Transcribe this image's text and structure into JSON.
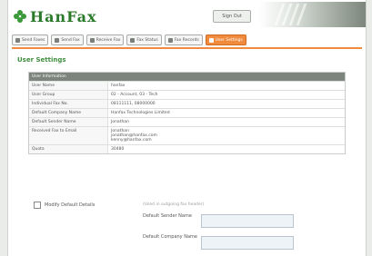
{
  "header": {
    "logo_text": "HanFax",
    "signout_label": "Sign Out"
  },
  "nav": {
    "items": [
      {
        "label": "Send Faxes",
        "icon": "send-icon"
      },
      {
        "label": "Send Fax",
        "icon": "fax-icon"
      },
      {
        "label": "Receive Fax",
        "icon": "inbox-icon"
      },
      {
        "label": "Fax Status",
        "icon": "status-icon"
      },
      {
        "label": "Fax Records",
        "icon": "records-icon"
      },
      {
        "label": "User Settings",
        "icon": "settings-icon",
        "active": true
      }
    ],
    "accent_color": "#f08a3c"
  },
  "page": {
    "title": "User Settings"
  },
  "user_info": {
    "header": "User Information",
    "rows": [
      {
        "label": "User Name",
        "values": [
          "hanfax"
        ]
      },
      {
        "label": "User Group",
        "values": [
          "02 - Account, 03 - Tech"
        ]
      },
      {
        "label": "Individual Fax No.",
        "values": [
          "08111111, 08000000"
        ]
      },
      {
        "label": "Default Company Name",
        "values": [
          "Hanfax Technologies Limited"
        ]
      },
      {
        "label": "Default Sender Name",
        "values": [
          "Jonathan"
        ]
      },
      {
        "label": "Received Fax to Email",
        "values": [
          "Jonathan",
          "jonathan@hanfax.com",
          "kenny@hanfax.com"
        ]
      },
      {
        "label": "Quota",
        "values": [
          "30480"
        ]
      }
    ]
  },
  "settings_form": {
    "modify_default_label": "Modify Default Details",
    "hint": "(Used in outgoing fax header)",
    "sender_name_label": "Default Sender Name",
    "sender_name_value": "",
    "company_name_label": "Default Company Name",
    "company_name_value": ""
  }
}
